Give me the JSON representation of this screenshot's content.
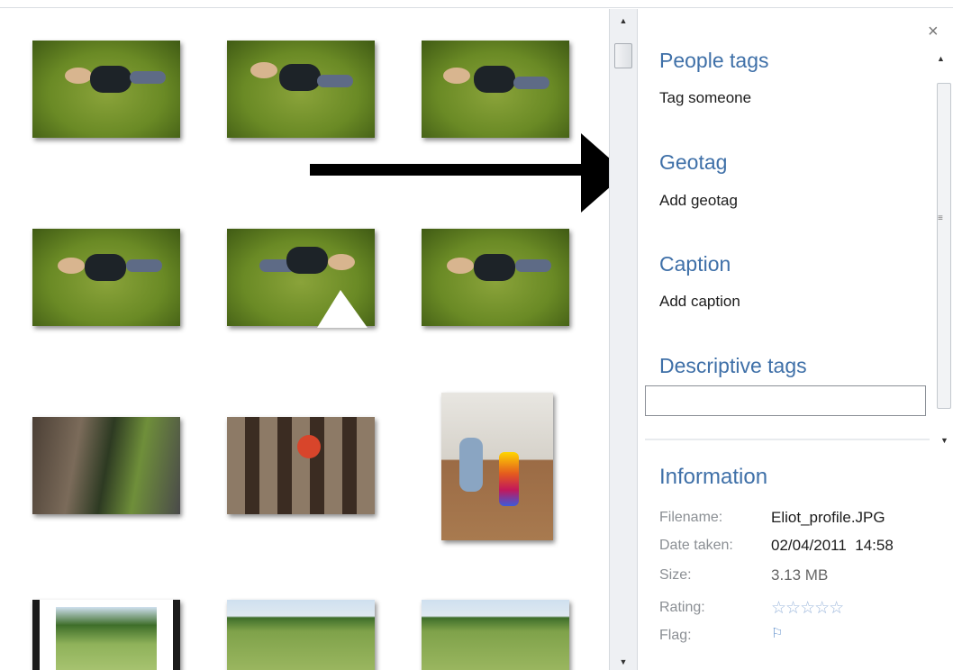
{
  "pane": {
    "close_label": "×",
    "sections": [
      {
        "title": "People tags",
        "action": "Tag someone"
      },
      {
        "title": "Geotag",
        "action": "Add geotag"
      },
      {
        "title": "Caption",
        "action": "Add caption"
      },
      {
        "title": "Descriptive tags"
      }
    ],
    "descriptive_tags_value": "",
    "information": {
      "title": "Information",
      "fields": [
        {
          "label": "Filename:",
          "value": "Eliot_profile.JPG"
        },
        {
          "label": "Date taken:",
          "value": "02/04/2011  14:58"
        },
        {
          "label": "Size:",
          "value": "3.13 MB"
        },
        {
          "label": "Rating:",
          "value": "☆☆☆☆☆"
        },
        {
          "label": "Flag:",
          "value": "⚐"
        }
      ],
      "rating": 0
    }
  },
  "icons": {
    "close": "close-icon",
    "scroll_up": "scroll-up-icon",
    "scroll_down": "scroll-down-icon",
    "flag": "flag-icon",
    "star": "star-icon"
  },
  "scroll_glyphs": {
    "up": "▲",
    "down": "▼",
    "grip": "≡"
  },
  "colors": {
    "accent": "#3f70a8",
    "star": "#9db8dc",
    "arrow": "#000000"
  }
}
